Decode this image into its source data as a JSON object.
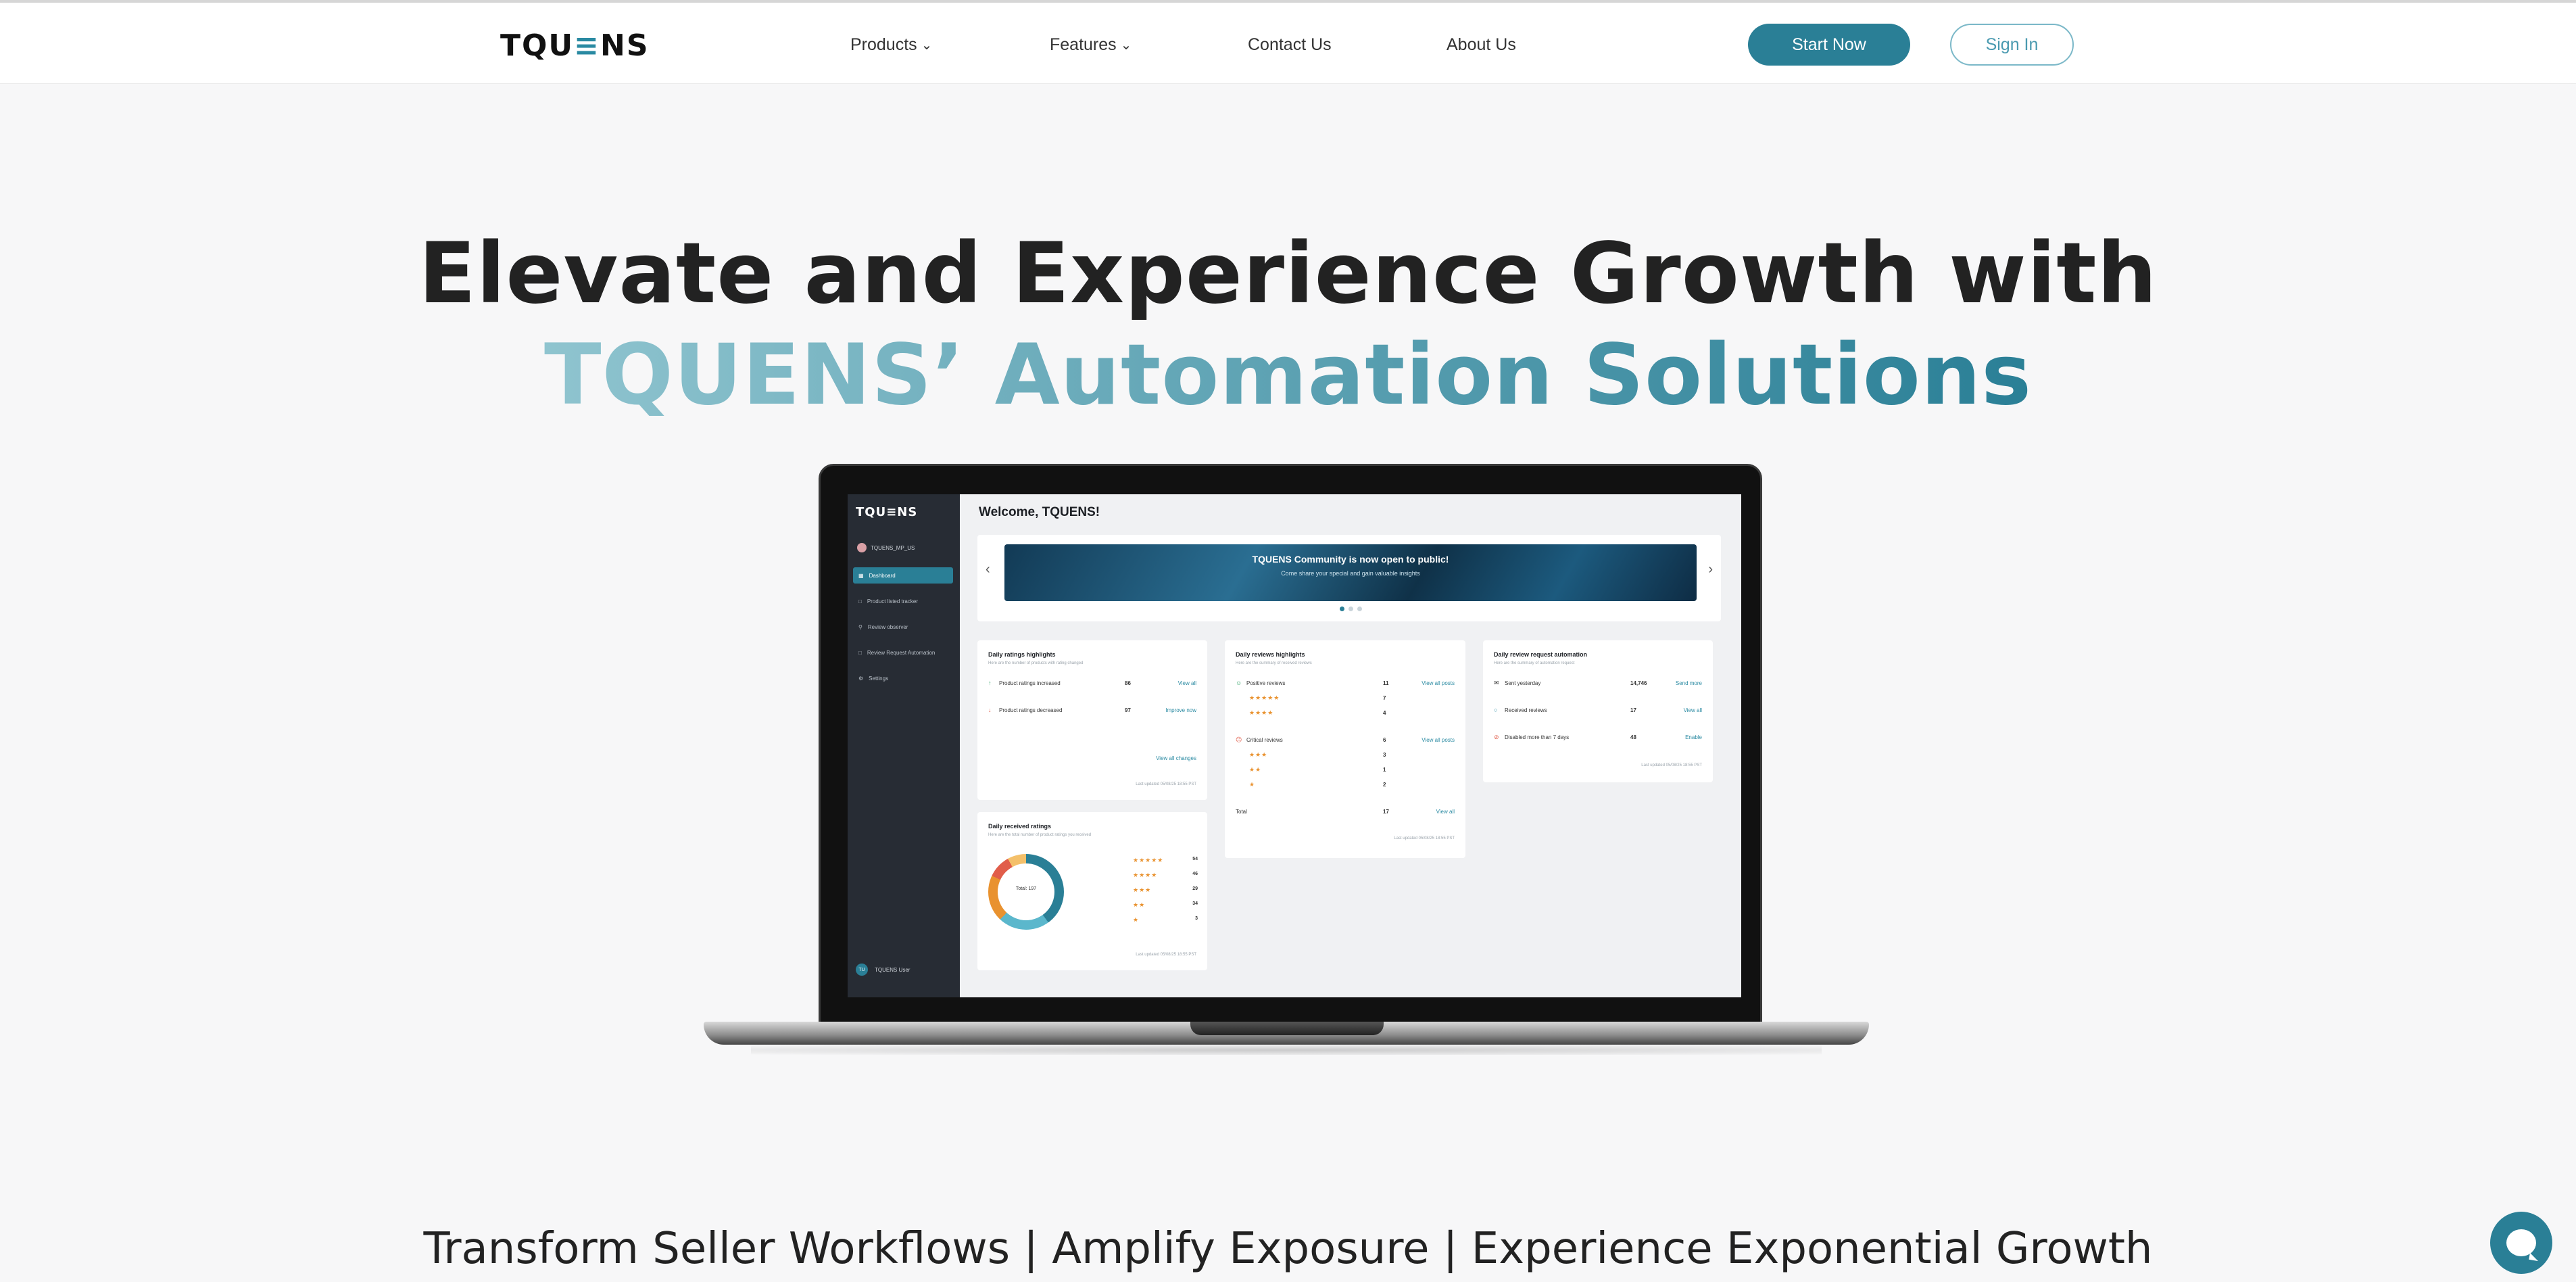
{
  "header": {
    "logo_a": "TQU",
    "logo_b": "≡",
    "logo_c": "NS",
    "nav": [
      {
        "label": "Products",
        "dropdown": true
      },
      {
        "label": "Features",
        "dropdown": true
      },
      {
        "label": "Contact Us",
        "dropdown": false
      },
      {
        "label": "About Us",
        "dropdown": false
      }
    ],
    "start_label": "Start Now",
    "signin_label": "Sign In"
  },
  "hero": {
    "line1": "Elevate and Experience Growth with",
    "line2": "TQUENS’ Automation Solutions"
  },
  "app": {
    "logo": "TQU≡NS",
    "account": "TQUENS_MP_US",
    "sidebar": [
      "Dashboard",
      "Product listed tracker",
      "Review observer",
      "Review Request Automation",
      "Settings"
    ],
    "user": "TQUENS User",
    "user_initials": "TU",
    "welcome": "Welcome, TQUENS!",
    "banner_title": "TQUENS Community is now open to public!",
    "banner_sub": "Come share your special and gain valuable insights",
    "ratings_highlights": {
      "title": "Daily ratings highlights",
      "sub": "Here are the number of products with rating changed",
      "rows": [
        {
          "icon": "↑",
          "label": "Product ratings increased",
          "value": "86",
          "link": "View all"
        },
        {
          "icon": "↓",
          "label": "Product ratings decreased",
          "value": "97",
          "link": "Improve now"
        }
      ],
      "link": "View all changes",
      "updated": "Last updated 05/08/25 18:55 PST"
    },
    "reviews_highlights": {
      "title": "Daily reviews highlights",
      "sub": "Here are the summary of received reviews",
      "positive_label": "Positive reviews",
      "positive_value": "11",
      "positive_link": "View all posts",
      "positive_stars": [
        {
          "stars": "★★★★★",
          "count": "7"
        },
        {
          "stars": "★★★★",
          "count": "4"
        }
      ],
      "critical_label": "Critical reviews",
      "critical_value": "6",
      "critical_link": "View all posts",
      "critical_stars": [
        {
          "stars": "★★★",
          "count": "3"
        },
        {
          "stars": "★★",
          "count": "1"
        },
        {
          "stars": "★",
          "count": "2"
        }
      ],
      "total_label": "Total",
      "total_value": "17",
      "total_link": "View all",
      "updated": "Last updated 05/08/25 18:55 PST"
    },
    "automation": {
      "title": "Daily review request automation",
      "sub": "Here are the summary of automation request",
      "rows": [
        {
          "label": "Sent yesterday",
          "value": "14,746",
          "link": "Send more"
        },
        {
          "label": "Received reviews",
          "value": "17",
          "link": "View all"
        },
        {
          "label": "Disabled more than 7 days",
          "value": "48",
          "link": "Enable"
        }
      ],
      "updated": "Last updated 05/08/25 18:55 PST"
    },
    "received_ratings": {
      "title": "Daily received ratings",
      "sub": "Here are the total number of product ratings you received",
      "total": "Total: 197",
      "rows": [
        {
          "stars": "★★★★★",
          "count": "54"
        },
        {
          "stars": "★★★★",
          "count": "46"
        },
        {
          "stars": "★★★",
          "count": "29"
        },
        {
          "stars": "★★",
          "count": "34"
        },
        {
          "stars": "★",
          "count": "3"
        }
      ],
      "updated": "Last updated 05/08/25 18:55 PST"
    }
  },
  "tagline": "Transform Seller Workflows | Amplify Exposure | Experience Exponential Growth",
  "colors": {
    "brand": "#2a7f96",
    "hero_gradient_start": "#8fc4cf",
    "hero_gradient_end": "#2a7f96"
  }
}
